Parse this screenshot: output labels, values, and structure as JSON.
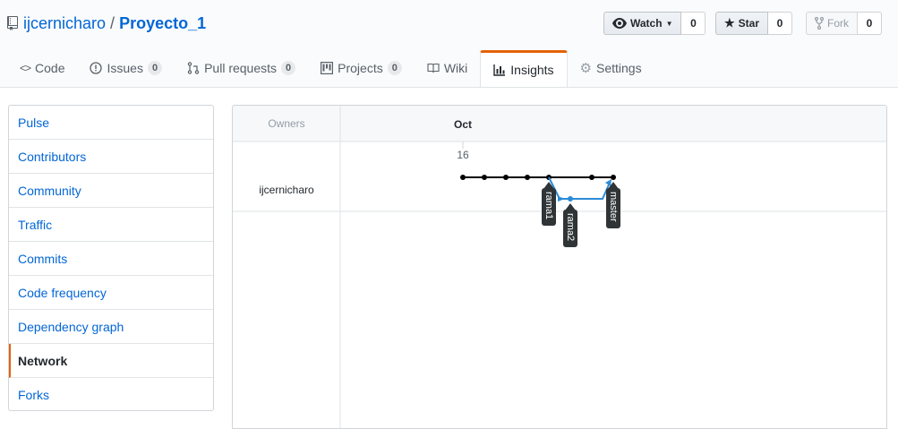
{
  "repo": {
    "owner": "ijcernicharo",
    "separator": "/",
    "name": "Proyecto_1"
  },
  "actions": {
    "watch": {
      "label": "Watch",
      "count": "0"
    },
    "star": {
      "label": "Star",
      "count": "0"
    },
    "fork": {
      "label": "Fork",
      "count": "0"
    }
  },
  "tabs": [
    {
      "label": "Code",
      "icon": "code-icon"
    },
    {
      "label": "Issues",
      "count": "0",
      "icon": "issue-icon"
    },
    {
      "label": "Pull requests",
      "count": "0",
      "icon": "pull-request-icon"
    },
    {
      "label": "Projects",
      "count": "0",
      "icon": "project-icon"
    },
    {
      "label": "Wiki",
      "icon": "book-icon"
    },
    {
      "label": "Insights",
      "icon": "graph-icon",
      "selected": true
    },
    {
      "label": "Settings",
      "icon": "gear-icon"
    }
  ],
  "menu": [
    "Pulse",
    "Contributors",
    "Community",
    "Traffic",
    "Commits",
    "Code frequency",
    "Dependency graph",
    "Network",
    "Forks"
  ],
  "menu_selected": "Network",
  "network": {
    "owners_header": "Owners",
    "month": "Oct",
    "day": "16",
    "owner": "ijcernicharo",
    "branches": [
      "rama1",
      "rama2",
      "master"
    ],
    "colors": {
      "main_line": "#000000",
      "branch_line": "#2b8bd6",
      "label_bg": "#2f3437"
    }
  },
  "colors": {
    "accent": "#e36209",
    "link": "#0366d6"
  }
}
